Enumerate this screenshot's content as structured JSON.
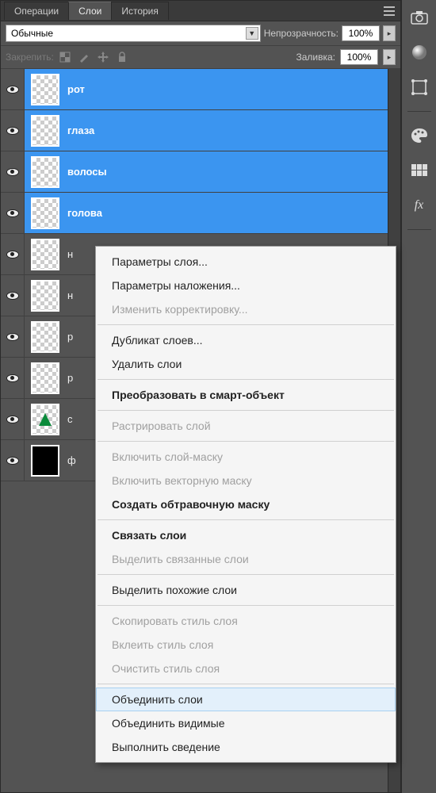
{
  "tabs": {
    "operations": "Операции",
    "layers": "Слои",
    "history": "История"
  },
  "blend": {
    "mode": "Обычные"
  },
  "opacity": {
    "label": "Непрозрачность:",
    "value": "100%"
  },
  "lock": {
    "label": "Закрепить:"
  },
  "fill": {
    "label": "Заливка:",
    "value": "100%"
  },
  "layers": [
    {
      "name": "рот",
      "selected": true
    },
    {
      "name": "глаза",
      "selected": true
    },
    {
      "name": "волосы",
      "selected": true
    },
    {
      "name": "голова",
      "selected": true
    },
    {
      "name": "н",
      "selected": false
    },
    {
      "name": "н",
      "selected": false
    },
    {
      "name": "р",
      "selected": false
    },
    {
      "name": "р",
      "selected": false
    },
    {
      "name": "с",
      "selected": false,
      "tree": true
    },
    {
      "name": "ф",
      "selected": false,
      "black": true
    }
  ],
  "ctx": {
    "layer_props": "Параметры слоя...",
    "blend_options": "Параметры наложения...",
    "edit_adjustment": "Изменить корректировку...",
    "duplicate": "Дубликат слоев...",
    "delete": "Удалить слои",
    "smart_object": "Преобразовать в смарт-объект",
    "rasterize": "Растрировать слой",
    "enable_mask": "Включить слой-маску",
    "enable_vector_mask": "Включить векторную маску",
    "clipping_mask": "Создать обтравочную маску",
    "link": "Связать слои",
    "select_linked": "Выделить связанные слои",
    "select_similar": "Выделить похожие слои",
    "copy_style": "Скопировать стиль слоя",
    "paste_style": "Вклеить стиль слоя",
    "clear_style": "Очистить стиль слоя",
    "merge": "Объединить слои",
    "merge_visible": "Объединить видимые",
    "flatten": "Выполнить сведение"
  }
}
